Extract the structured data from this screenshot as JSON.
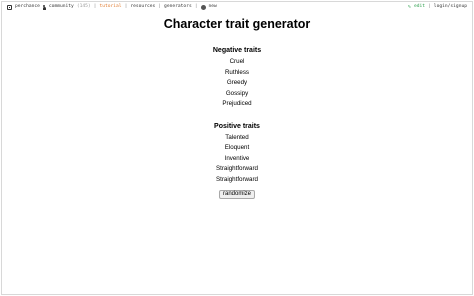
{
  "nav": {
    "brand": "perchance",
    "community": "community",
    "community_count": "(145)",
    "separator": "|",
    "tutorial": "tutorial",
    "resources": "resources",
    "generators": "generators",
    "new": "new",
    "edit_icon": "✎",
    "edit": "edit",
    "login": "login/signup",
    "icons": {
      "brand": "perchance-logo-icon",
      "community": "person-icon",
      "new": "globe-icon",
      "edit": "pencil-icon"
    },
    "colors": {
      "tutorial": "#e07a2e",
      "edit": "#2a9d4a"
    }
  },
  "page": {
    "title": "Character trait generator",
    "negative": {
      "heading": "Negative traits",
      "items": [
        "Cruel",
        "Ruthless",
        "Greedy",
        "Gossipy",
        "Prejudiced"
      ]
    },
    "positive": {
      "heading": "Positive traits",
      "items": [
        "Talented",
        "Eloquent",
        "Inventive",
        "Straightforward",
        "Straightforward"
      ]
    },
    "button": "randomize"
  }
}
